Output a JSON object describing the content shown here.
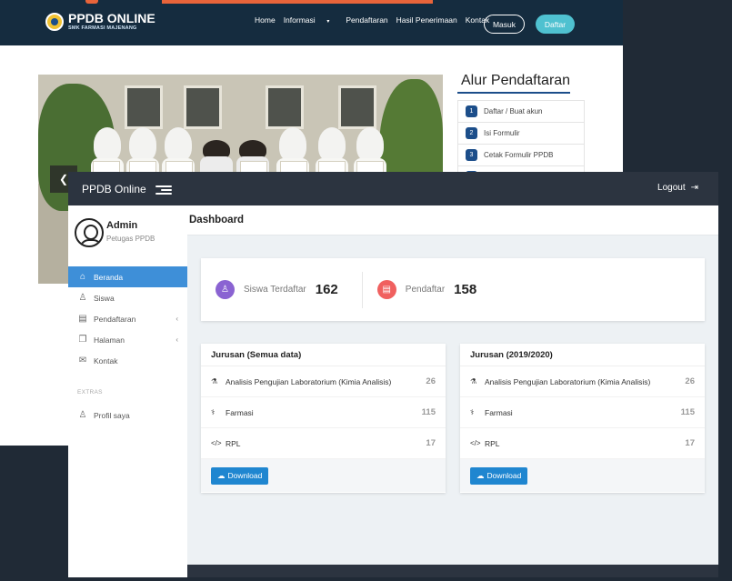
{
  "site": {
    "brand_title": "PPDB ONLINE",
    "brand_subtitle": "SMK FARMASI MAJENANG",
    "menu": {
      "home": "Home",
      "informasi": "Informasi",
      "pendaftaran": "Pendaftaran",
      "hasil": "Hasil Penerimaan",
      "kontak": "Kontak"
    },
    "btn_masuk": "Masuk",
    "btn_daftar": "Daftar",
    "alur_title": "Alur Pendaftaran",
    "alur_steps": [
      {
        "num": "1",
        "label": "Daftar / Buat akun"
      },
      {
        "num": "2",
        "label": "Isi Formulir"
      },
      {
        "num": "3",
        "label": "Cetak Formulir PPDB"
      }
    ]
  },
  "admin": {
    "app_name": "PPDB Online",
    "logout_label": "Logout",
    "profile": {
      "name": "Admin",
      "role": "Petugas PPDB"
    },
    "nav": {
      "beranda": "Beranda",
      "siswa": "Siswa",
      "pendaftaran": "Pendaftaran",
      "halaman": "Halaman",
      "kontak": "Kontak",
      "section_extras": "EXTRAS",
      "profil": "Profil saya"
    },
    "page_title": "Dashboard",
    "stats": {
      "siswa_label": "Siswa Terdaftar",
      "siswa_value": "162",
      "pendaftar_label": "Pendaftar",
      "pendaftar_value": "158"
    },
    "card_all": {
      "title": "Jurusan (Semua data)",
      "rows": [
        {
          "name": "Analisis Pengujian Laboratorium (Kimia Analisis)",
          "count": "26"
        },
        {
          "name": "Farmasi",
          "count": "115"
        },
        {
          "name": "RPL",
          "count": "17"
        }
      ],
      "download_label": "Download"
    },
    "card_year": {
      "title": "Jurusan (2019/2020)",
      "rows": [
        {
          "name": "Analisis Pengujian Laboratorium (Kimia Analisis)",
          "count": "26"
        },
        {
          "name": "Farmasi",
          "count": "115"
        },
        {
          "name": "RPL",
          "count": "17"
        }
      ],
      "download_label": "Download"
    },
    "colors": {
      "accent": "#3e8fd8",
      "stat_siswa": "#8a63d2",
      "stat_pendaftar": "#f0605f",
      "topbar": "#2c3440"
    }
  }
}
